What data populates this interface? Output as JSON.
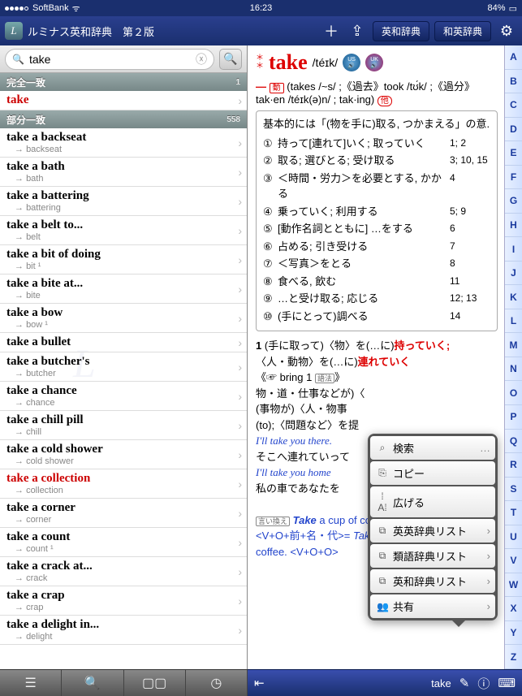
{
  "status": {
    "carrier": "SoftBank",
    "wifi": "᯾",
    "time": "16:23",
    "battery": "84%"
  },
  "header": {
    "title": "ルミナス英和辞典　第２版",
    "btn1": "英和辞典",
    "btn2": "和英辞典"
  },
  "search": {
    "value": "take",
    "placeholder": ""
  },
  "sections": {
    "exact": {
      "label": "完全一致",
      "count": "1"
    },
    "partial": {
      "label": "部分一致",
      "count": "558"
    }
  },
  "exact_results": [
    {
      "word": "take",
      "red": true
    }
  ],
  "partial_results": [
    {
      "word": "take a backseat",
      "sub": "backseat"
    },
    {
      "word": "take a bath",
      "sub": "bath"
    },
    {
      "word": "take a battering",
      "sub": "battering"
    },
    {
      "word": "take a belt to...",
      "sub": "belt"
    },
    {
      "word": "take a bit of doing",
      "sub": "bit ¹"
    },
    {
      "word": "take a bite at...",
      "sub": "bite"
    },
    {
      "word": "take a bow",
      "sub": "bow ¹"
    },
    {
      "word": "take a bullet",
      "sub": ""
    },
    {
      "word": "take a butcher's",
      "sub": "butcher"
    },
    {
      "word": "take a chance",
      "sub": "chance"
    },
    {
      "word": "take a chill pill",
      "sub": "chill"
    },
    {
      "word": "take a cold shower",
      "sub": "cold shower"
    },
    {
      "word": "take a collection",
      "sub": "collection",
      "red": true
    },
    {
      "word": "take a corner",
      "sub": "corner"
    },
    {
      "word": "take a count",
      "sub": "count ¹"
    },
    {
      "word": "take a crack at...",
      "sub": "crack"
    },
    {
      "word": "take a crap",
      "sub": "crap"
    },
    {
      "word": "take a delight in...",
      "sub": "delight"
    }
  ],
  "entry": {
    "headword": "take",
    "pron": "/téɪk/",
    "forms": "(takes  /~s/  ;《過去》took  /tʊ́k/ ;《過分》tak·en  /téɪk(ə)n/  ; tak·ing)",
    "pos": "動",
    "trans_label": "他",
    "intro": "基本的には「(物を手に)取る, つかまえる」の意.",
    "defs": [
      {
        "n": "①",
        "t": "持って[連れて]いく; 取っていく",
        "r": "1; 2"
      },
      {
        "n": "②",
        "t": "取る; 選びとる; 受け取る",
        "r": "3; 10, 15"
      },
      {
        "n": "③",
        "t": "＜時間・労力＞を必要とする, かかる",
        "r": "4"
      },
      {
        "n": "④",
        "t": "乗っていく; 利用する",
        "r": "5; 9"
      },
      {
        "n": "⑤",
        "t": "[動作名詞とともに] …をする",
        "r": "6"
      },
      {
        "n": "⑥",
        "t": "占める; 引き受ける",
        "r": "7"
      },
      {
        "n": "⑦",
        "t": "＜写真＞をとる",
        "r": "8"
      },
      {
        "n": "⑧",
        "t": "食べる, 飲む",
        "r": "11"
      },
      {
        "n": "⑨",
        "t": "…と受け取る; 応じる",
        "r": "12; 13"
      },
      {
        "n": "⑩",
        "t": "(手にとって)調べる",
        "r": "14"
      }
    ],
    "sense1_a": "(手に取って)〈物〉を(…に)",
    "sense1_a_red": "持っていく;",
    "sense1_b": "〈人・動物〉を(…に)",
    "sense1_b_red": "連れていく",
    "bring": "《☞ bring 1",
    "goho": "語法",
    "line3": "物・道・仕事などが)〈",
    "line4": "(事物が)〈人・物事",
    "line5": "(to);〈問題など〉を提",
    "ex1": "I'll take you there.",
    "ex1_ja": "そこへ連れていって",
    "ex2": "I'll take you home",
    "ex2_ja": "私の車であなたを",
    "iikae_label": "言い換え",
    "iikae": "Take  a cup of coffee to  your father.  <V+O+前+名・代>= Take your father a cup of coffee.  <V+O+O>"
  },
  "popup": [
    {
      "icon": "⌕",
      "label": "検索",
      "more": "…"
    },
    {
      "icon": "⎘",
      "label": "コピー"
    },
    {
      "icon": "⁞A⁞",
      "label": "広げる"
    },
    {
      "icon": "⧉",
      "label": "英英辞典リスト",
      "chev": true
    },
    {
      "icon": "⧉",
      "label": "類語辞典リスト",
      "chev": true
    },
    {
      "icon": "⧉",
      "label": "英和辞典リスト",
      "chev": true
    },
    {
      "icon": "👥",
      "label": "共有",
      "chev": true
    }
  ],
  "alpha": [
    "A",
    "B",
    "C",
    "D",
    "E",
    "F",
    "G",
    "H",
    "I",
    "J",
    "K",
    "L",
    "M",
    "N",
    "O",
    "P",
    "Q",
    "R",
    "S",
    "T",
    "U",
    "V",
    "W",
    "X",
    "Y",
    "Z"
  ],
  "bottom": {
    "word": "take"
  }
}
